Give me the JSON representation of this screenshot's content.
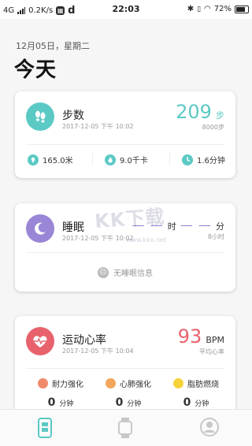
{
  "status_bar": {
    "network": "4G",
    "speed": "0.2K/s",
    "time": "22:03",
    "battery": "72%"
  },
  "header": {
    "date": "12月05日，星期二",
    "title": "今天"
  },
  "steps_card": {
    "title": "步数",
    "timestamp": "2017-12-05 下午 10:02",
    "value": "209",
    "unit": "步",
    "goal": "8000步",
    "stats": [
      {
        "icon": "location-icon",
        "value": "165.0米"
      },
      {
        "icon": "flame-icon",
        "value": "9.0千卡"
      },
      {
        "icon": "clock-icon",
        "value": "1.6分钟"
      }
    ],
    "accent": "#5bc9c4"
  },
  "sleep_card": {
    "title": "睡眠",
    "timestamp": "2017-12-05 下午 10:02",
    "hours_placeholder": "— —",
    "hours_unit": "时",
    "minutes_placeholder": "— —",
    "minutes_unit": "分",
    "goal": "8小时",
    "empty_message": "无睡眠信息",
    "accent": "#9a86d6"
  },
  "heart_card": {
    "title": "运动心率",
    "timestamp": "2017-12-05 下午 10:04",
    "value": "93",
    "unit": "BPM",
    "subtitle": "平均心率",
    "zones": [
      {
        "label": "耐力强化",
        "value": "0",
        "unit": "分钟",
        "color": "#f08a6c"
      },
      {
        "label": "心肺强化",
        "value": "0",
        "unit": "分钟",
        "color": "#f3a55a"
      },
      {
        "label": "脂肪燃烧",
        "value": "0",
        "unit": "分钟",
        "color": "#f6d23a"
      }
    ],
    "accent": "#e8626d"
  },
  "watermark": {
    "text": "KK下载",
    "url": "www.kkx.net"
  },
  "tabs": [
    {
      "name": "tab-today",
      "icon": "phone-icon",
      "active": true
    },
    {
      "name": "tab-watch",
      "icon": "watch-icon",
      "active": false
    },
    {
      "name": "tab-profile",
      "icon": "avatar-icon",
      "active": false
    }
  ]
}
